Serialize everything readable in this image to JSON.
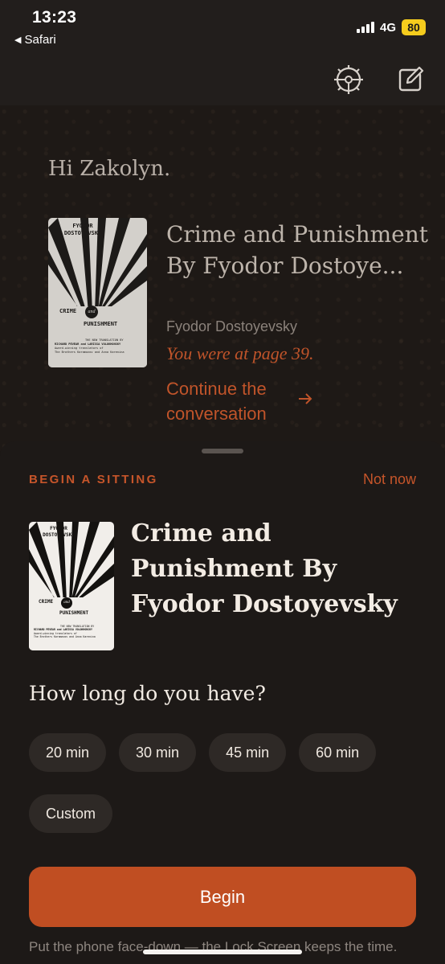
{
  "status_bar": {
    "time": "13:23",
    "back_app": "Safari",
    "network": "4G",
    "battery": "80",
    "battery_color": "#f5cc1d"
  },
  "toolbar": {
    "settings_icon": "gear-steering-icon",
    "compose_icon": "compose-icon"
  },
  "home": {
    "greeting": "Hi Zakolyn.",
    "current_book": {
      "title": "Crime and Punishment By Fyodor Dostoye...",
      "author": "Fyodor Dostoyevsky",
      "progress_note": "You were at page 39.",
      "continue_label": "Continue the conversation"
    }
  },
  "cover": {
    "author_line1": "FYODOR",
    "author_line2": "DOSTOYEVSKY",
    "title_line1": "CRIME",
    "title_and": "and",
    "title_line2": "PUNISHMENT",
    "sub1": "THE NEW TRANSLATION BY",
    "sub2": "RICHARD PEVEAR and LARISSA VOLOKHONSKY",
    "sub3": "Award-winning translators of",
    "sub4": "The Brothers Karamazov and Anna Karenina"
  },
  "sheet": {
    "label": "BEGIN A SITTING",
    "dismiss_label": "Not now",
    "book_title": "Crime and Punishment By Fyodor Dostoyevsky",
    "question": "How long do you have?",
    "durations": [
      {
        "label": "20 min"
      },
      {
        "label": "30 min"
      },
      {
        "label": "45 min"
      },
      {
        "label": "60 min"
      },
      {
        "label": "Custom"
      }
    ],
    "begin_label": "Begin",
    "footnote": "Put the phone face-down — the Lock Screen keeps the time."
  },
  "colors": {
    "accent": "#c04e22",
    "background": "#1c1714"
  }
}
